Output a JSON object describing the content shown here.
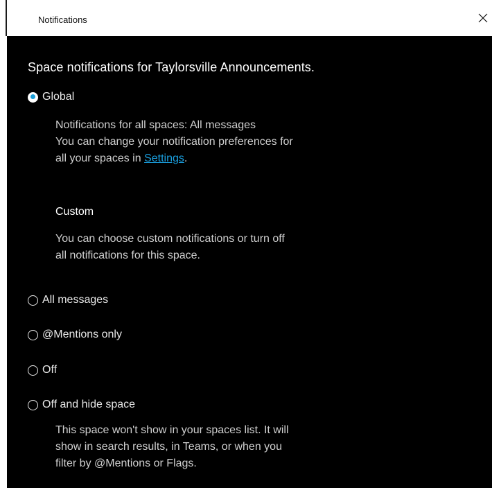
{
  "dialog": {
    "title": "Notifications",
    "heading": "Space notifications for Taylorsville Announcements."
  },
  "global": {
    "label": "Global",
    "checked": true,
    "desc_line1": "Notifications for all spaces: All messages",
    "desc_line2": "You can change your notification preferences for",
    "desc_line3_prefix": "all your spaces in ",
    "settings_link": "Settings",
    "desc_line3_suffix": "."
  },
  "custom": {
    "heading": "Custom",
    "desc_line1": "You can choose custom notifications or turn off",
    "desc_line2": "all notifications for this space."
  },
  "options": {
    "all_messages": "All messages",
    "mentions_only": "@Mentions only",
    "off": "Off",
    "off_and_hide": "Off and hide space"
  },
  "hide_desc": {
    "line1": "This space won't show in your spaces list. It will",
    "line2": "show in search results, in Teams, or when you",
    "line3": "filter by @Mentions or Flags."
  },
  "colors": {
    "background": "#000000",
    "accent": "#1a9ed8",
    "link": "#1aa0e0"
  },
  "icons": {
    "close": "close-icon"
  }
}
